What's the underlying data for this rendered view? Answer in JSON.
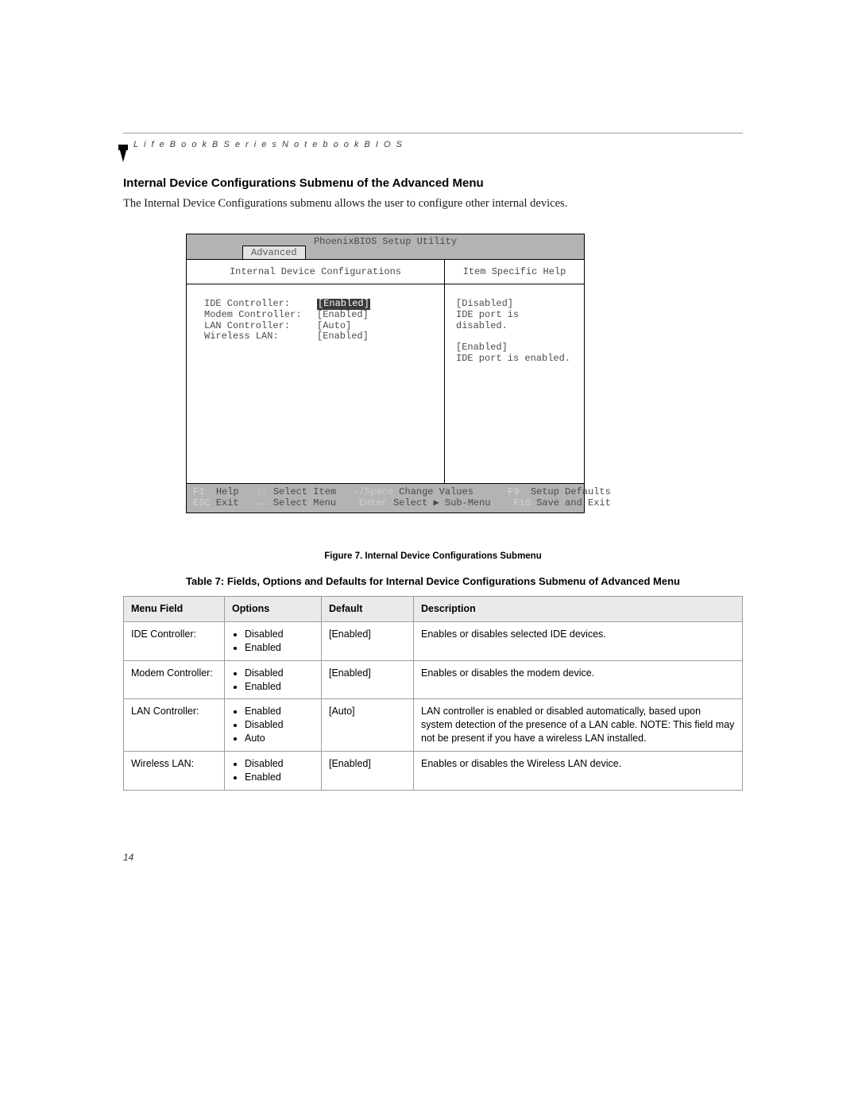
{
  "header": {
    "running": "L i f e B o o k   B   S e r i e s   N o t e b o o k   B I O S",
    "page_number": "14"
  },
  "title": "Internal Device Configurations Submenu of the Advanced Menu",
  "intro": "The Internal Device Configurations submenu allows the user to configure other internal devices.",
  "bios": {
    "utility_title": "PhoenixBIOS Setup Utility",
    "active_tab": "Advanced",
    "left_heading": "Internal Device Configurations",
    "right_heading": "Item Specific Help",
    "rows": [
      {
        "label": "IDE Controller:",
        "value": "[Enabled]",
        "selected": true
      },
      {
        "label": "Modem Controller:",
        "value": "[Enabled]",
        "selected": false
      },
      {
        "label": "LAN Controller:",
        "value": "[Auto]",
        "selected": false
      },
      {
        "label": "Wireless LAN:",
        "value": "[Enabled]",
        "selected": false
      }
    ],
    "help": {
      "l1": "[Disabled]",
      "l2": "IDE port is disabled.",
      "l3": "[Enabled]",
      "l4": "IDE port is enabled."
    },
    "footer": {
      "f1": "F1",
      "help": "Help",
      "selitem_key": "↑↓",
      "selitem": "Select Item",
      "chg_key": "-/Space",
      "chg": "Change Values",
      "f9": "F9",
      "setup_defaults": "Setup Defaults",
      "esc": "ESC",
      "exit": "Exit",
      "selmenu_key": "←→",
      "selmenu": "Select Menu",
      "enter": "Enter",
      "submenu": "Select ▶ Sub-Menu",
      "f10": "F10",
      "save_exit": "Save and Exit"
    }
  },
  "figure_caption": "Figure 7.  Internal Device Configurations Submenu",
  "table_caption": "Table 7: Fields, Options and Defaults for Internal Device Configurations Submenu of Advanced Menu",
  "table": {
    "headers": {
      "field": "Menu Field",
      "options": "Options",
      "default": "Default",
      "desc": "Description"
    },
    "rows": [
      {
        "field": "IDE Controller:",
        "options": [
          "Disabled",
          "Enabled"
        ],
        "default": "[Enabled]",
        "desc": "Enables or disables selected IDE devices."
      },
      {
        "field": "Modem Controller:",
        "options": [
          "Disabled",
          "Enabled"
        ],
        "default": "[Enabled]",
        "desc": "Enables or disables the modem device."
      },
      {
        "field": "LAN Controller:",
        "options": [
          "Enabled",
          "Disabled",
          "Auto"
        ],
        "default": "[Auto]",
        "desc": "LAN controller is enabled or disabled automatically, based upon system detection of the presence of a LAN cable. NOTE: This field may not be present if you have a wireless LAN installed."
      },
      {
        "field": "Wireless LAN:",
        "options": [
          "Disabled",
          "Enabled"
        ],
        "default": "[Enabled]",
        "desc": "Enables or disables the Wireless LAN device."
      }
    ]
  }
}
